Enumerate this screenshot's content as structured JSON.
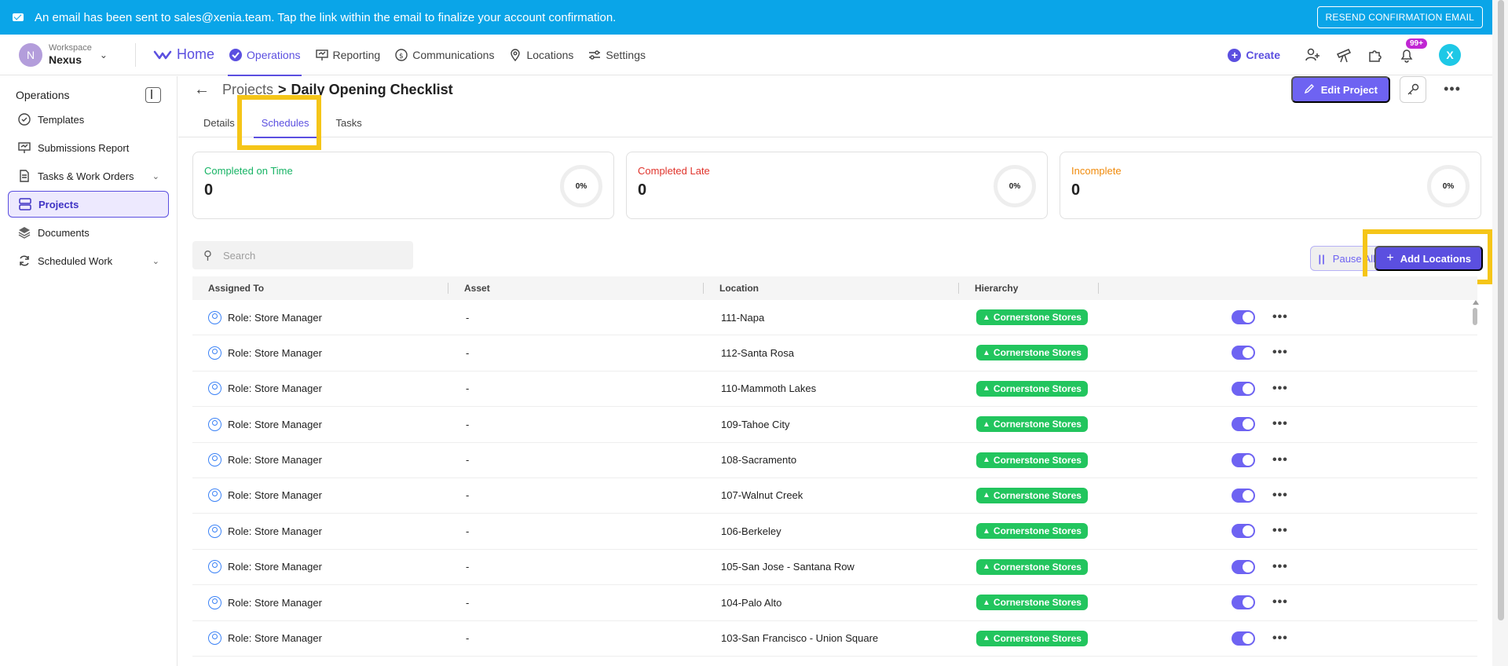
{
  "banner": {
    "message": "An email has been sent to sales@xenia.team. Tap the link within the email to finalize your account confirmation.",
    "resend_label": "RESEND CONFIRMATION EMAIL"
  },
  "workspace": {
    "avatar_letter": "N",
    "label": "Workspace",
    "name": "Nexus"
  },
  "topnav": {
    "home": "Home",
    "operations": "Operations",
    "reporting": "Reporting",
    "communications": "Communications",
    "locations": "Locations",
    "settings": "Settings",
    "create": "Create",
    "notifications_badge": "99+",
    "user_avatar": "X"
  },
  "sidebar": {
    "title": "Operations",
    "items": [
      {
        "label": "Templates",
        "icon": "check-circle-icon"
      },
      {
        "label": "Submissions Report",
        "icon": "presentation-chart-icon"
      },
      {
        "label": "Tasks & Work Orders",
        "icon": "document-icon"
      },
      {
        "label": "Projects",
        "icon": "server-stack-icon"
      },
      {
        "label": "Documents",
        "icon": "layers-icon"
      },
      {
        "label": "Scheduled Work",
        "icon": "refresh-icon"
      }
    ]
  },
  "header": {
    "breadcrumb_parent": "Projects",
    "breadcrumb_separator": ">",
    "title": "Daily Opening Checklist",
    "edit_label": "Edit Project"
  },
  "tabs": [
    "Details",
    "Schedules",
    "Tasks"
  ],
  "cards": [
    {
      "title": "Completed on Time",
      "value": "0",
      "percent": "0%",
      "color": "#16b364"
    },
    {
      "title": "Completed Late",
      "value": "0",
      "percent": "0%",
      "color": "#e0342c"
    },
    {
      "title": "Incomplete",
      "value": "0",
      "percent": "0%",
      "color": "#f08a0a"
    }
  ],
  "search": {
    "placeholder": "Search"
  },
  "actions": {
    "pause_label": "Pause All",
    "add_label": "Add Locations"
  },
  "table": {
    "columns": [
      "Assigned To",
      "Asset",
      "Location",
      "Hierarchy"
    ],
    "rows": [
      {
        "assigned": "Role: Store Manager",
        "asset": "-",
        "location": "111-Napa",
        "hierarchy": "Cornerstone Stores"
      },
      {
        "assigned": "Role: Store Manager",
        "asset": "-",
        "location": "112-Santa Rosa",
        "hierarchy": "Cornerstone Stores"
      },
      {
        "assigned": "Role: Store Manager",
        "asset": "-",
        "location": "110-Mammoth Lakes",
        "hierarchy": "Cornerstone Stores"
      },
      {
        "assigned": "Role: Store Manager",
        "asset": "-",
        "location": "109-Tahoe City",
        "hierarchy": "Cornerstone Stores"
      },
      {
        "assigned": "Role: Store Manager",
        "asset": "-",
        "location": "108-Sacramento",
        "hierarchy": "Cornerstone Stores"
      },
      {
        "assigned": "Role: Store Manager",
        "asset": "-",
        "location": "107-Walnut Creek",
        "hierarchy": "Cornerstone Stores"
      },
      {
        "assigned": "Role: Store Manager",
        "asset": "-",
        "location": "106-Berkeley",
        "hierarchy": "Cornerstone Stores"
      },
      {
        "assigned": "Role: Store Manager",
        "asset": "-",
        "location": "105-San Jose - Santana Row",
        "hierarchy": "Cornerstone Stores"
      },
      {
        "assigned": "Role: Store Manager",
        "asset": "-",
        "location": "104-Palo Alto",
        "hierarchy": "Cornerstone Stores"
      },
      {
        "assigned": "Role: Store Manager",
        "asset": "-",
        "location": "103-San Francisco - Union Square",
        "hierarchy": "Cornerstone Stores"
      }
    ]
  }
}
